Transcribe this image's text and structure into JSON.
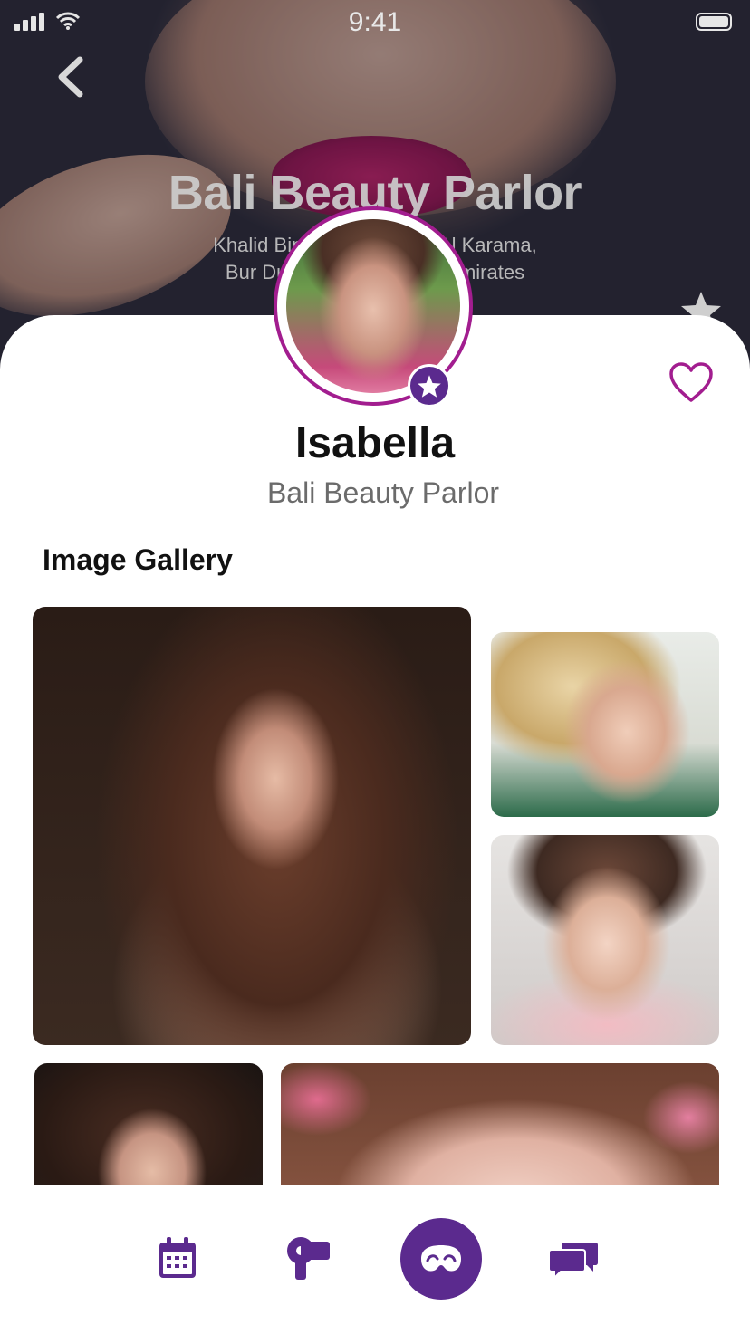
{
  "status_bar": {
    "time": "9:41"
  },
  "header": {
    "title": "Bali Beauty Parlor",
    "address_line1": "Khalid Bin Al Waleed Rd, Al Karama,",
    "address_line2": "Bur Dubai – United Arab Emirates"
  },
  "profile": {
    "name": "Isabella",
    "salon": "Bali Beauty Parlor",
    "favorite": false
  },
  "gallery": {
    "title": "Image Gallery",
    "images": [
      "curly-hair-portrait",
      "blonde-portrait",
      "skincare-portrait",
      "dark-hair-portrait",
      "makeup-eyes-closeup"
    ]
  },
  "tabbar": {
    "items": [
      "calendar-icon",
      "hair-dryer-icon",
      "beauty-mask-icon",
      "chat-icon"
    ],
    "active": "beauty-mask-icon"
  },
  "colors": {
    "accent": "#5b2a8e",
    "ring": "#a21d8f"
  }
}
